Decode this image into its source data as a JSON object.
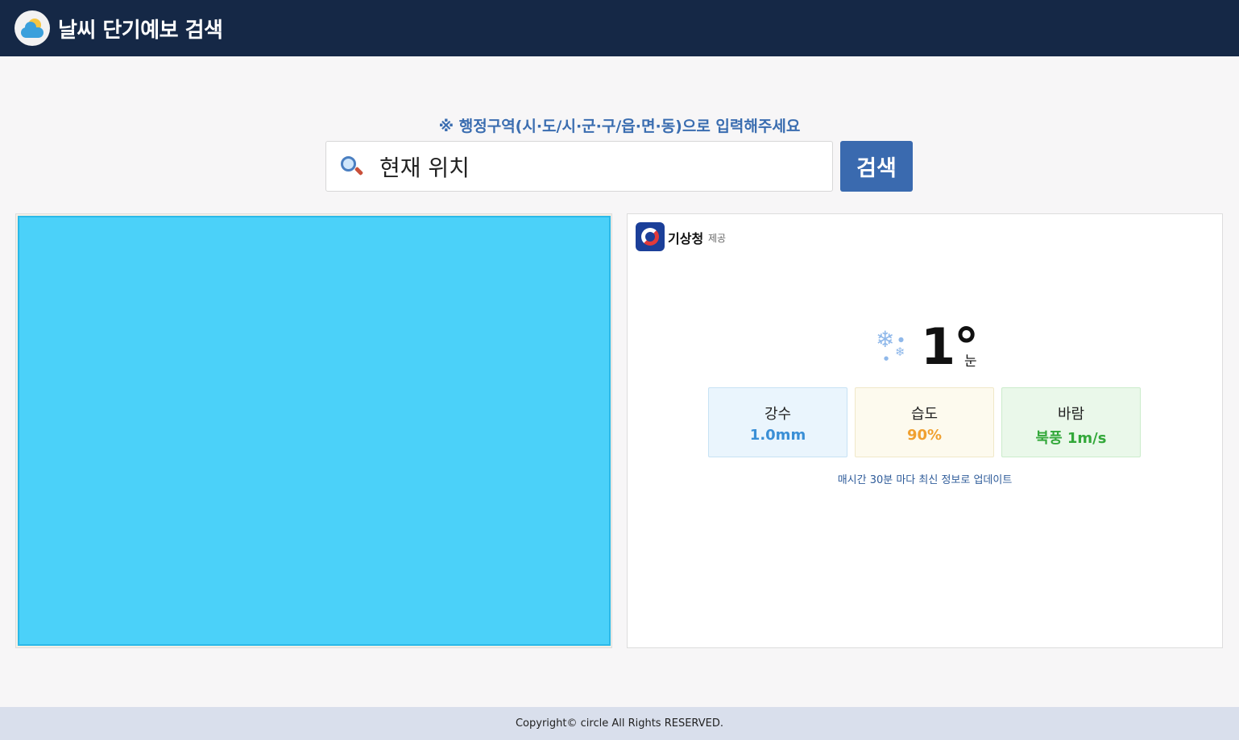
{
  "header": {
    "title": "날씨 단기예보 검색"
  },
  "search": {
    "hint": "※ 행정구역(시·도/시·군·구/읍·면·동)으로 입력해주세요",
    "value": "현재 위치",
    "button_label": "검색"
  },
  "provider": {
    "name": "기상청",
    "suffix": "제공"
  },
  "current": {
    "temperature": "1°",
    "condition": "눈",
    "icon": "snow-icon"
  },
  "stats": {
    "precipitation": {
      "label": "강수",
      "value": "1.0mm"
    },
    "humidity": {
      "label": "습도",
      "value": "90%"
    },
    "wind": {
      "label": "바람",
      "value": "북풍 1m/s"
    }
  },
  "update_note": "매시간 30분 마다 최신 정보로 업데이트",
  "footer": {
    "copyright": "Copyright© circle All Rights RESERVED."
  },
  "colors": {
    "header_bg": "#152846",
    "accent": "#3a6aaf",
    "map_overlay": "#4bd1f9",
    "rain": "#3a8fd6",
    "humidity": "#f0a030",
    "wind": "#33a83a"
  }
}
